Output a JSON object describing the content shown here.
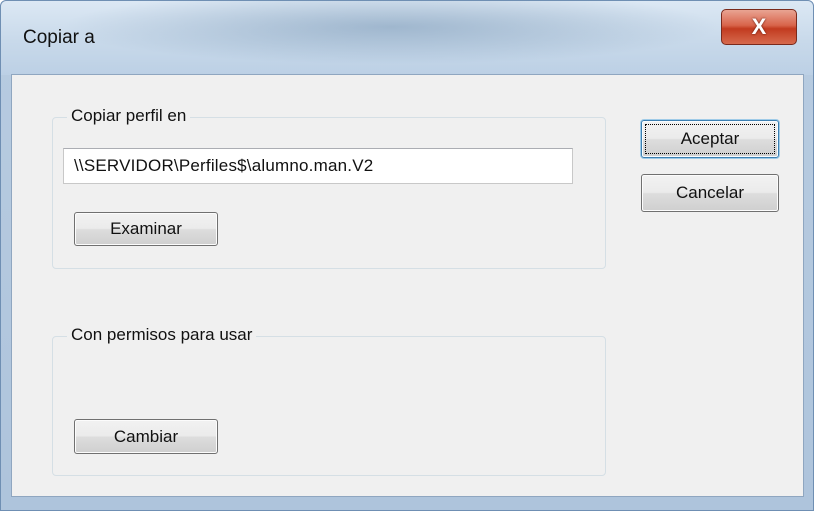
{
  "window": {
    "title": "Copiar a",
    "close_glyph": "X",
    "close_icon": "close-icon"
  },
  "copy_profile": {
    "legend": "Copiar perfil en",
    "path_value": "\\\\SERVIDOR\\Perfiles$\\alumno.man.V2",
    "browse_label": "Examinar"
  },
  "permissions": {
    "legend": "Con permisos para usar",
    "change_label": "Cambiar"
  },
  "actions": {
    "ok_label": "Aceptar",
    "cancel_label": "Cancelar"
  },
  "colors": {
    "close_button": "#c23b20",
    "dialog_background": "#f0f0f0",
    "default_button_border": "#3c7fb1"
  }
}
